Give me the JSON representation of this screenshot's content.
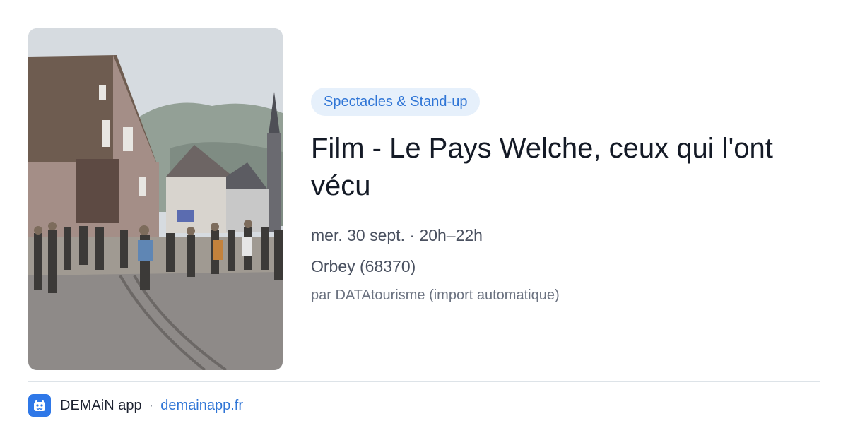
{
  "event": {
    "category": "Spectacles & Stand-up",
    "title": "Film - Le Pays Welche, ceux qui l'ont vécu",
    "date_time": "mer. 30 sept. · 20h–22h",
    "location": "Orbey (68370)",
    "source": "par DATAtourisme (import automatique)"
  },
  "footer": {
    "app_name": "DEMAiN app",
    "separator": "·",
    "link": "demainapp.fr"
  },
  "colors": {
    "accent": "#2f75d6",
    "tag_background": "#e6f0fb",
    "logo_background": "#2f78e8",
    "title": "#141a26"
  },
  "icons": {
    "app_logo": "demain-app-logo-icon"
  }
}
